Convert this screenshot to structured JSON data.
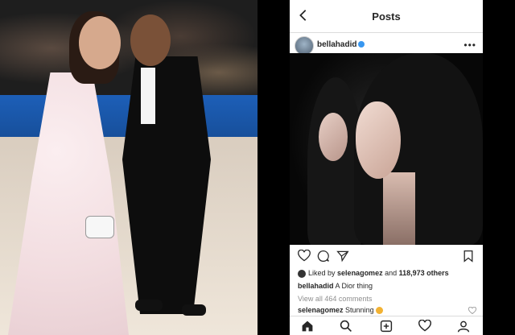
{
  "photo": {
    "alt_subject": "red-carpet-photo"
  },
  "instagram": {
    "header": {
      "title": "Posts"
    },
    "post": {
      "username": "bellahadid",
      "liked_by_prefix": "Liked by",
      "liked_by_user": "selenagomez",
      "liked_by_and": "and",
      "liked_by_others": "118,973 others",
      "caption_user": "bellahadid",
      "caption_text": "A Dior thing",
      "view_comments": "View all 464 comments",
      "comment_user": "selenagomez",
      "comment_text": "Stunning"
    },
    "icons": {
      "back": "chevron-left-icon",
      "more": "more-icon",
      "like": "heart-icon",
      "comment": "comment-icon",
      "share": "send-icon",
      "save": "bookmark-icon",
      "nav": [
        "home-icon",
        "search-icon",
        "add-icon",
        "activity-icon",
        "profile-icon"
      ]
    },
    "colors": {
      "verified": "#3897f0",
      "text": "#262626",
      "muted": "#8e8e8e"
    }
  }
}
